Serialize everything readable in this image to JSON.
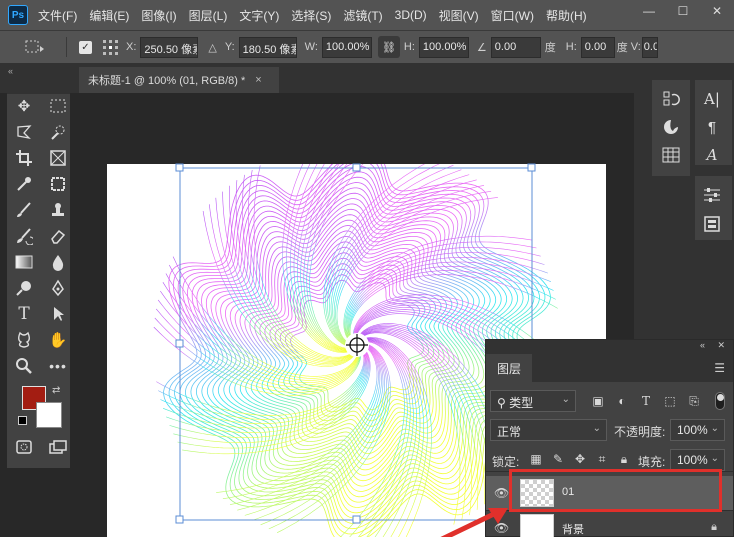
{
  "app": {
    "logo": "Ps"
  },
  "menu": [
    "文件(F)",
    "编辑(E)",
    "图像(I)",
    "图层(L)",
    "文字(Y)",
    "选择(S)",
    "滤镜(T)",
    "3D(D)",
    "视图(V)",
    "窗口(W)",
    "帮助(H)"
  ],
  "window_controls": {
    "minimize": "—",
    "maximize": "☐",
    "close": "✕"
  },
  "options": {
    "x_label": "X:",
    "x_value": "250.50 像素",
    "y_label": "Y:",
    "y_value": "180.50 像素",
    "w_label": "W:",
    "w_value": "100.00%",
    "h_label": "H:",
    "h_value": "100.00%",
    "angle_value": "0.00",
    "angle_unit": "度",
    "skew_h_label": "H:",
    "skew_h_value": "0.00",
    "skew_unit": "度",
    "skew_v_label": "V:",
    "skew_v_value": "0.0"
  },
  "document_tab": {
    "title": "未标题-1 @ 100% (01, RGB/8) *",
    "close": "×"
  },
  "colors": {
    "foreground": "#a31d12",
    "background": "#ffffff",
    "selection_highlight": "#e0302b"
  },
  "layers_panel": {
    "tab": "图层",
    "filter_type": "类型",
    "blend_mode": "正常",
    "opacity_label": "不透明度:",
    "opacity_value": "100%",
    "lock_label": "锁定:",
    "fill_label": "填充:",
    "fill_value": "100%",
    "layers": [
      {
        "name": "01",
        "selected": true,
        "visible": true
      },
      {
        "name": "背景",
        "selected": false,
        "visible": true,
        "locked": true
      }
    ]
  }
}
